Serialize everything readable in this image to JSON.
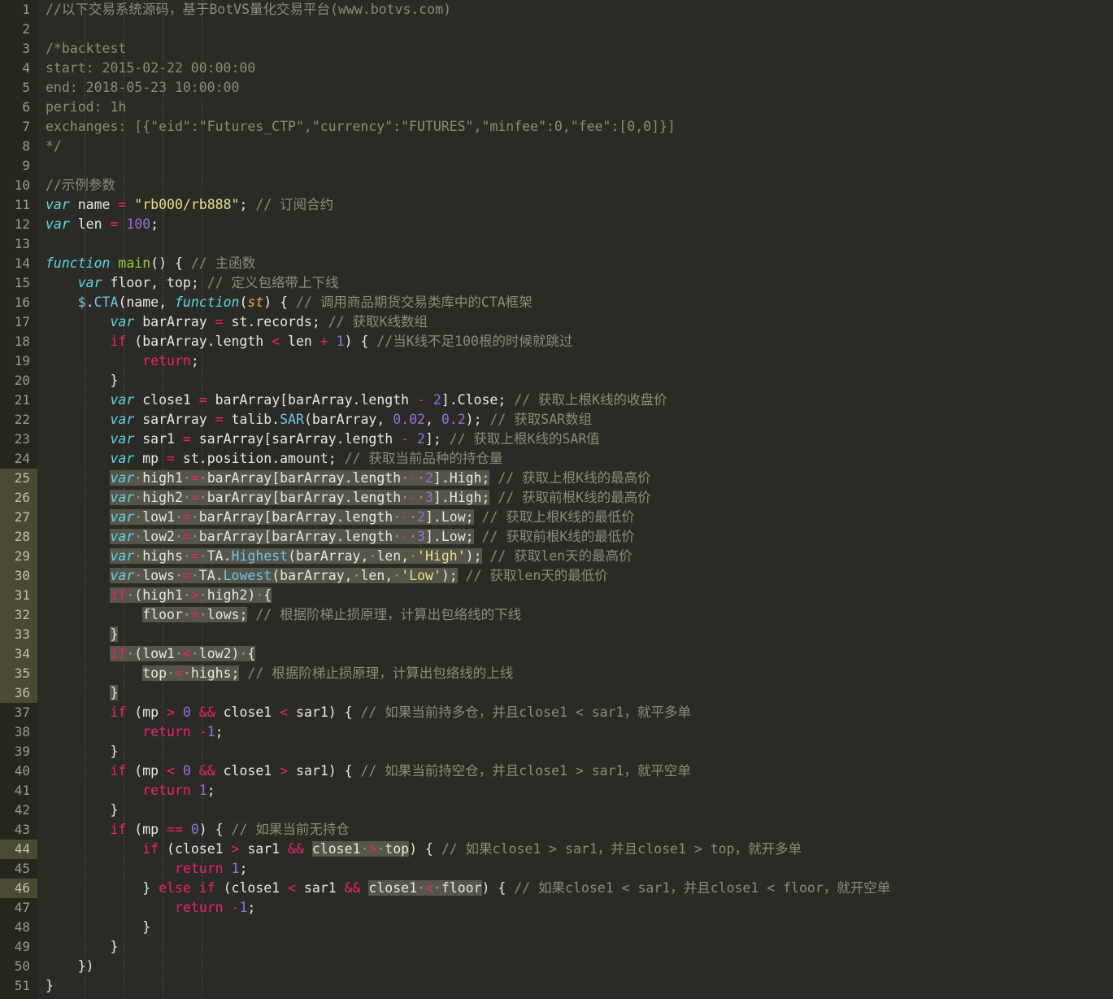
{
  "editor": {
    "name": "code-editor",
    "language": "javascript",
    "total_lines": 51,
    "theme": {
      "background": "#2b2b26",
      "gutter_background": "#26261f",
      "gutter_text": "#9c9c8c",
      "gutter_highlight": "#4a4a33",
      "selection": "#55554a",
      "foreground": "#e8e8e0",
      "comment": "#8b8b78",
      "keyword": "#f0206e",
      "var_keyword": "#5fd7e8",
      "function_name": "#9acd32",
      "parameter": "#ffa726",
      "number": "#9b6bdf",
      "string": "#ece08a",
      "method": "#6fc6e8"
    },
    "highlighted_lines": [
      25,
      26,
      27,
      28,
      29,
      30,
      31,
      32,
      33,
      34,
      35,
      36,
      44,
      46
    ]
  },
  "line_numbers": [
    "1",
    "2",
    "3",
    "4",
    "5",
    "6",
    "7",
    "8",
    "9",
    "10",
    "11",
    "12",
    "13",
    "14",
    "15",
    "16",
    "17",
    "18",
    "19",
    "20",
    "21",
    "22",
    "23",
    "24",
    "25",
    "26",
    "27",
    "28",
    "29",
    "30",
    "31",
    "32",
    "33",
    "34",
    "35",
    "36",
    "37",
    "38",
    "39",
    "40",
    "41",
    "42",
    "43",
    "44",
    "45",
    "46",
    "47",
    "48",
    "49",
    "50",
    "51"
  ],
  "code": {
    "l1": "//以下交易系统源码，基于BotVS量化交易平台(www.botvs.com)",
    "l2": "",
    "l3": "/*backtest",
    "l4": "start: 2015-02-22 00:00:00",
    "l5": "end: 2018-05-23 10:00:00",
    "l6": "period: 1h",
    "l7": "exchanges: [{\"eid\":\"Futures_CTP\",\"currency\":\"FUTURES\",\"minfee\":0,\"fee\":[0,0]}]",
    "l8": "*/",
    "l9": "",
    "l10": "//示例参数",
    "l11": "var name = \"rb000/rb888\"; // 订阅合约",
    "l12": "var len = 100;",
    "l13": "",
    "l14": "function main() { // 主函数",
    "l15": "    var floor, top; // 定义包络带上下线",
    "l16": "    $.CTA(name, function(st) { // 调用商品期货交易类库中的CTA框架",
    "l17": "        var barArray = st.records; // 获取K线数组",
    "l18": "        if (barArray.length < len + 1) { //当K线不足100根的时候就跳过",
    "l19": "            return;",
    "l20": "        }",
    "l21": "        var close1 = barArray[barArray.length - 2].Close; // 获取上根K线的收盘价",
    "l22": "        var sarArray = talib.SAR(barArray, 0.02, 0.2); // 获取SAR数组",
    "l23": "        var sar1 = sarArray[sarArray.length - 2]; // 获取上根K线的SAR值",
    "l24": "        var mp = st.position.amount; // 获取当前品种的持仓量",
    "l25": "        var high1 = barArray[barArray.length - 2].High; // 获取上根K线的最高价",
    "l26": "        var high2 = barArray[barArray.length - 3].High; // 获取前根K线的最高价",
    "l27": "        var low1 = barArray[barArray.length - 2].Low; // 获取上根K线的最低价",
    "l28": "        var low2 = barArray[barArray.length - 3].Low; // 获取前根K线的最低价",
    "l29": "        var highs = TA.Highest(barArray, len, 'High'); // 获取len天的最高价",
    "l30": "        var lows = TA.Lowest(barArray, len, 'Low'); // 获取len天的最低价",
    "l31": "        if (high1 > high2) {",
    "l32": "            floor = lows; // 根据阶梯止损原理，计算出包络线的下线",
    "l33": "        }",
    "l34": "        if (low1 < low2) {",
    "l35": "            top = highs; // 根据阶梯止损原理，计算出包络线的上线",
    "l36": "        }",
    "l37": "        if (mp > 0 && close1 < sar1) { // 如果当前持多仓，并且close1 < sar1，就平多单",
    "l38": "            return -1;",
    "l39": "        }",
    "l40": "        if (mp < 0 && close1 > sar1) { // 如果当前持空仓，并且close1 > sar1，就平空单",
    "l41": "            return 1;",
    "l42": "        }",
    "l43": "        if (mp == 0) { // 如果当前无持仓",
    "l44": "            if (close1 > sar1 && close1 > top) { // 如果close1 > sar1，并且close1 > top，就开多单",
    "l45": "                return 1;",
    "l46": "            } else if (close1 < sar1 && close1 < floor) { // 如果close1 < sar1，并且close1 < floor，就开空单",
    "l47": "                return -1;",
    "l48": "            }",
    "l49": "        }",
    "l50": "    })",
    "l51": "}"
  },
  "tokens": {
    "comment_line1": "//以下交易系统源码，基于BotVS量化交易平台(www.botvs.com)",
    "backtest_open": "/*backtest",
    "backtest_start": "start: 2015-02-22 00:00:00",
    "backtest_end": "end: 2018-05-23 10:00:00",
    "backtest_period": "period: 1h",
    "backtest_exchanges": "exchanges: [{\"eid\":\"Futures_CTP\",\"currency\":\"FUTURES\",\"minfee\":0,\"fee\":[0,0]}]",
    "backtest_close": "*/",
    "comment_params": "//示例参数",
    "kw_var": "var",
    "kw_function": "function",
    "kw_if": "if",
    "kw_else": "else",
    "kw_return": "return",
    "name_main": "main",
    "name_st": "st",
    "name_name": "name",
    "name_len": "len",
    "val_name": "\"rb000/rb888\"",
    "val_len": "100",
    "comment_name": "// 订阅合约",
    "comment_main": "// 主函数",
    "comment_floor_top": "// 定义包络带上下线",
    "comment_cta": "// 调用商品期货交易类库中的CTA框架",
    "comment_bararray": "// 获取K线数组",
    "comment_skip": "//当K线不足100根的时候就跳过",
    "comment_close1": "// 获取上根K线的收盘价",
    "comment_sararray": "// 获取SAR数组",
    "comment_sar1": "// 获取上根K线的SAR值",
    "comment_mp": "// 获取当前品种的持仓量",
    "comment_high1": "// 获取上根K线的最高价",
    "comment_high2": "// 获取前根K线的最高价",
    "comment_low1": "// 获取上根K线的最低价",
    "comment_low2": "// 获取前根K线的最低价",
    "comment_highs": "// 获取len天的最高价",
    "comment_lows": "// 获取len天的最低价",
    "comment_floor": "// 根据阶梯止损原理，计算出包络线的下线",
    "comment_top": "// 根据阶梯止损原理，计算出包络线的上线",
    "comment_closelong": "// 如果当前持多仓，并且close1 < sar1，就平多单",
    "comment_closeshort": "// 如果当前持空仓，并且close1 > sar1，就平空单",
    "comment_noposition": "// 如果当前无持仓",
    "comment_openlong": "// 如果close1 > sar1，并且close1 > top，就开多单",
    "comment_openshort": "// 如果close1 < sar1，并且close1 < floor，就开空单",
    "str_high": "'High'",
    "str_low": "'Low'",
    "method_sar": "SAR",
    "method_highest": "Highest",
    "method_lowest": "Lowest",
    "method_cta": "CTA"
  }
}
